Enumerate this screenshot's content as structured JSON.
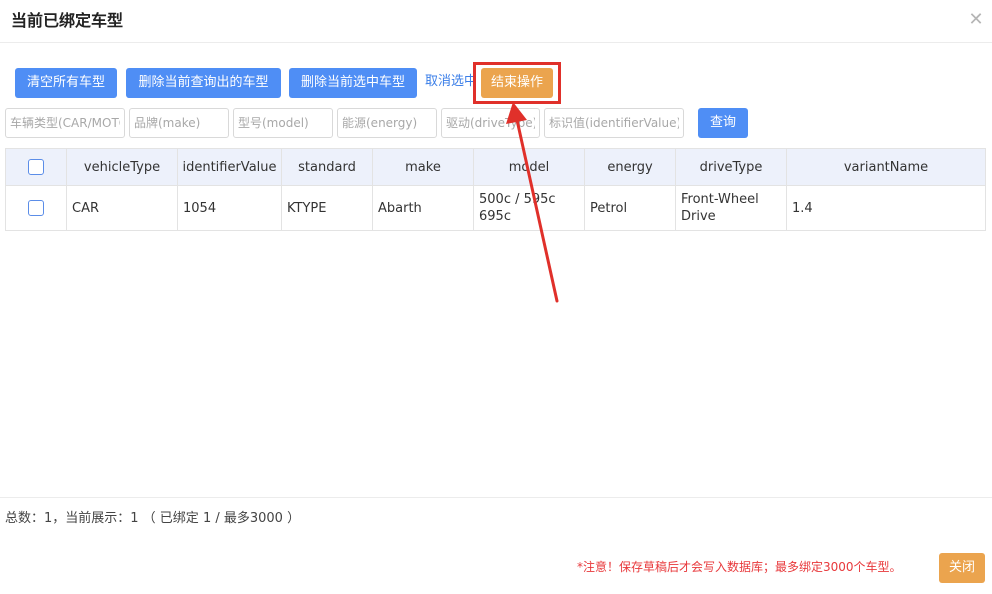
{
  "dialog": {
    "title": "当前已绑定车型",
    "close_glyph": "✕"
  },
  "toolbar": {
    "clear_all_label": "清空所有车型",
    "delete_queried_label": "删除当前查询出的车型",
    "delete_selected_label": "删除当前选中车型",
    "deselect_label": "取消选中",
    "end_operation_label": "结束操作"
  },
  "filters": {
    "vehicle_type_placeholder": "车辆类型(CAR/MOTO)",
    "make_placeholder": "品牌(make)",
    "model_placeholder": "型号(model)",
    "energy_placeholder": "能源(energy)",
    "drive_type_placeholder": "驱动(driveType)",
    "identifier_placeholder": "标识值(identifierValue)",
    "query_label": "查询"
  },
  "table": {
    "columns": [
      "vehicleType",
      "identifierValue",
      "standard",
      "make",
      "model",
      "energy",
      "driveType",
      "variantName"
    ],
    "rows": [
      {
        "vehicleType": "CAR",
        "identifierValue": "1054",
        "standard": "KTYPE",
        "make": "Abarth",
        "model": "500c / 595c 695c",
        "energy": "Petrol",
        "driveType": "Front-Wheel Drive",
        "variantName": "1.4"
      }
    ]
  },
  "footer": {
    "summary": "总数：1，当前展示：1 （ 已绑定 1 / 最多3000 ）",
    "notice": "*注意！保存草稿后才会写入数据库；最多绑定3000个车型。",
    "close_label": "关闭"
  },
  "colors": {
    "primary": "#4f8ef5",
    "warning": "#eba44e",
    "annotation": "#e0302a",
    "notice": "#e8383b"
  }
}
